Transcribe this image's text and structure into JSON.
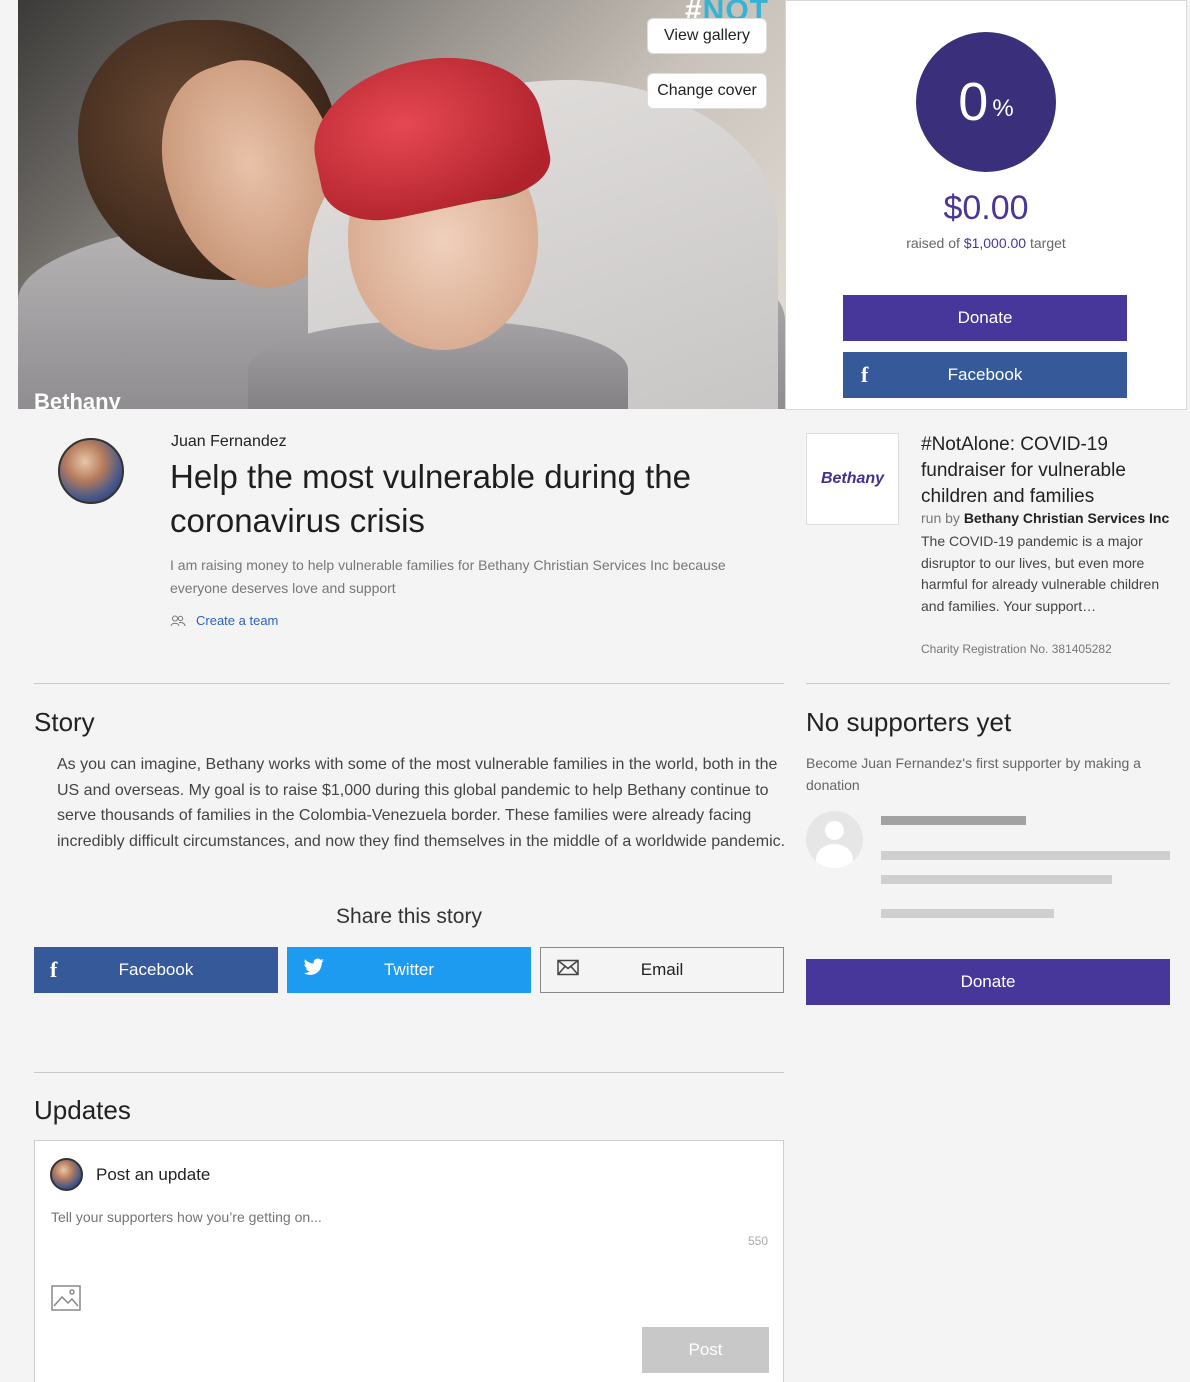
{
  "hero": {
    "tag_hash": "#",
    "tag_text": "NOT",
    "brand": "Bethany",
    "view_gallery": "View gallery",
    "change_cover": "Change cover"
  },
  "progress": {
    "percent_number": "0",
    "percent_sign": "%",
    "percent_value": 0,
    "raised_amount": "$0.00",
    "raised_prefix": "raised of ",
    "target_amount": "$1,000.00",
    "target_suffix": " target",
    "donate_label": "Donate",
    "facebook_label": "Facebook",
    "accent_color": "#48379a"
  },
  "page": {
    "owner": "Juan Fernandez",
    "title": "Help the most vulnerable during the coronavirus crisis",
    "intro": "I am raising money to help vulnerable families for Bethany Christian Services Inc because everyone deserves love and support",
    "create_team": "Create a team"
  },
  "charity": {
    "logo_text": "Bethany",
    "title": "#NotAlone: COVID-19 fundraiser for vulnerable children and families",
    "run_by_prefix": "run by ",
    "run_by_name": "Bethany Christian Services Inc",
    "description": "The COVID-19 pandemic is a major disruptor to our lives, but even more harmful for already vulnerable children and families. Your support…",
    "registration": "Charity Registration No. 381405282"
  },
  "story": {
    "heading": "Story",
    "body": "As you can imagine, Bethany works with some of the most vulnerable families in the world, both in the US and overseas. My goal is to raise $1,000 during this global pandemic to help Bethany continue to serve thousands of families in the Colombia-Venezuela border. These families were already facing incredibly difficult circumstances, and now they find themselves in the middle of a worldwide pandemic.",
    "share_heading": "Share this story",
    "share_facebook": "Facebook",
    "share_twitter": "Twitter",
    "share_email": "Email"
  },
  "supporters": {
    "heading": "No supporters yet",
    "text": "Become Juan Fernandez's first supporter by making a donation",
    "donate_label": "Donate"
  },
  "updates": {
    "heading": "Updates",
    "post_label": "Post an update",
    "placeholder": "Tell your supporters how you’re getting on...",
    "char_count": "550",
    "post_button": "Post"
  }
}
